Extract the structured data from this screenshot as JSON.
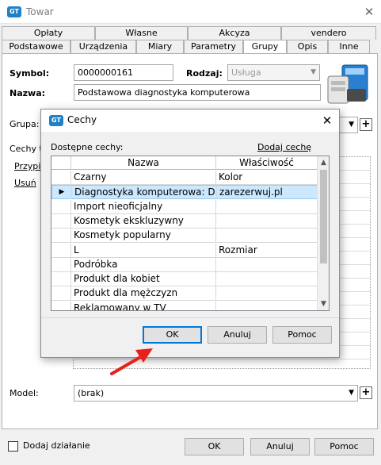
{
  "window": {
    "title": "Towar",
    "logo_text": "GT"
  },
  "tabs_top": [
    "Opłaty",
    "Własne",
    "Akcyza",
    "vendero"
  ],
  "tabs_bottom": [
    "Podstawowe",
    "Urządzenia",
    "Miary",
    "Parametry",
    "Grupy",
    "Opis",
    "Inne"
  ],
  "active_tab": "Grupy",
  "form": {
    "symbol_label": "Symbol:",
    "symbol_value": "0000000161",
    "rodzaj_label": "Rodzaj:",
    "rodzaj_value": "Usługa",
    "nazwa_label": "Nazwa:",
    "nazwa_value": "Podstawowa diagnostyka komputerowa",
    "grupa_label": "Grupa:",
    "cechy_label": "Cechy to",
    "przypisz_link": "Przypis",
    "usun_link": "Usuń",
    "model_label": "Model:",
    "model_value": "(brak)"
  },
  "footer": {
    "checkbox_label": "Dodaj działanie",
    "ok": "OK",
    "cancel": "Anuluj",
    "help": "Pomoc"
  },
  "dialog": {
    "title": "Cechy",
    "available_label": "Dostępne cechy:",
    "add_link": "Dodaj cechę",
    "columns": [
      "Nazwa",
      "Właściwość"
    ],
    "rows": [
      {
        "name": "Czarny",
        "prop": "Kolor"
      },
      {
        "name": "Diagnostyka komputerowa: D",
        "prop": "zarezerwuj.pl"
      },
      {
        "name": "Import nieoficjalny",
        "prop": ""
      },
      {
        "name": "Kosmetyk ekskluzywny",
        "prop": ""
      },
      {
        "name": "Kosmetyk popularny",
        "prop": ""
      },
      {
        "name": "L",
        "prop": "Rozmiar"
      },
      {
        "name": "Podróbka",
        "prop": ""
      },
      {
        "name": "Produkt dla kobiet",
        "prop": ""
      },
      {
        "name": "Produkt dla mężczyzn",
        "prop": ""
      },
      {
        "name": "Reklamowany w TV",
        "prop": ""
      }
    ],
    "selected_row": 1,
    "ok": "OK",
    "cancel": "Anuluj",
    "help": "Pomoc"
  },
  "colors": {
    "accent": "#0078d7",
    "selection": "#cce8ff",
    "arrow": "#e8201a"
  }
}
